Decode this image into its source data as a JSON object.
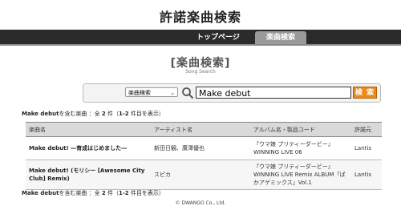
{
  "site": {
    "title": "許諾楽曲検索"
  },
  "nav": {
    "home": "トップページ",
    "search": "楽曲検索"
  },
  "heading": {
    "title": "[楽曲検索]",
    "subtitle": "Song Search"
  },
  "search": {
    "field_option": "楽曲検索",
    "query": "Make debut",
    "button": "検 索"
  },
  "result_summary": {
    "query": "Make debut",
    "text1": "を含む楽曲 ：全 ",
    "total": "2",
    "text2": " 件（",
    "range": "1-2",
    "text3": " 件目を表示）"
  },
  "table": {
    "headers": [
      "楽曲名",
      "アーティスト名",
      "アルバム名・製品コード",
      "許諾元"
    ],
    "rows": [
      {
        "song": "Make debut! ―育成はじめました―",
        "artist": "新田日観、廣澤優也",
        "album": "『ウマ娘 プリティーダービー』WINNING LIVE 06",
        "licensor": "Lantis"
      },
      {
        "song": "Make debut! (モリシー [Awesome City Club] Remix)",
        "artist": "スピカ",
        "album": "『ウマ娘 プリティーダービー』WINNING LIVE Remix ALBUM「ぱかアゲミックス」Vol.1",
        "licensor": "Lantis"
      }
    ]
  },
  "footer": {
    "copyright": "© DWANGO Co., Ltd."
  }
}
